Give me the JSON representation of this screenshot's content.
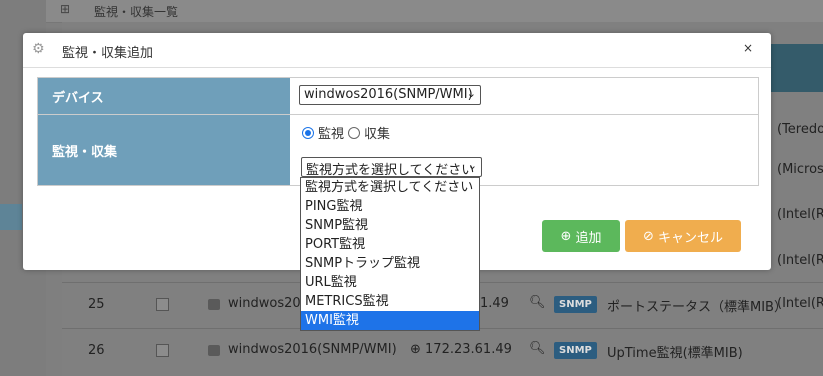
{
  "background": {
    "topbar_title": "監視・収集一覧",
    "rows": [
      {
        "num": "25",
        "device": "windwos201",
        "ip": "1.49",
        "badge": "SNMP",
        "desc": "ポートステータス（標準MIB）",
        "extra": "(Intel(R"
      },
      {
        "num": "26",
        "device": "windwos2016(SNMP/WMI)",
        "ip": "172.23.61.49",
        "badge": "SNMP",
        "desc": "UpTime監視(標準MIB)",
        "extra": ""
      }
    ],
    "side_texts": [
      "(Teredo",
      "(Microso",
      "(Intel(R",
      "(Intel(R"
    ]
  },
  "dialog": {
    "title": "監視・収集追加",
    "close_label": "×",
    "device_label": "デバイス",
    "device_value": "windwos2016(SNMP/WMI)",
    "monitor_label": "監視・収集",
    "radio_monitor": "監視",
    "radio_collect": "収集",
    "method_value": "監視方式を選択してください",
    "add_button": "追加",
    "cancel_button": "キャンセル"
  },
  "dropdown": {
    "options": [
      "監視方式を選択してください",
      "PING監視",
      "SNMP監視",
      "PORT監視",
      "SNMPトラップ監視",
      "URL監視",
      "METRICS監視",
      "WMI監視"
    ],
    "highlighted_index": 7
  },
  "colors": {
    "label_bg": "#6f9fba",
    "add_green": "#5cb85c",
    "cancel_orange": "#f0ad4e",
    "highlight_blue": "#1e73e8"
  }
}
